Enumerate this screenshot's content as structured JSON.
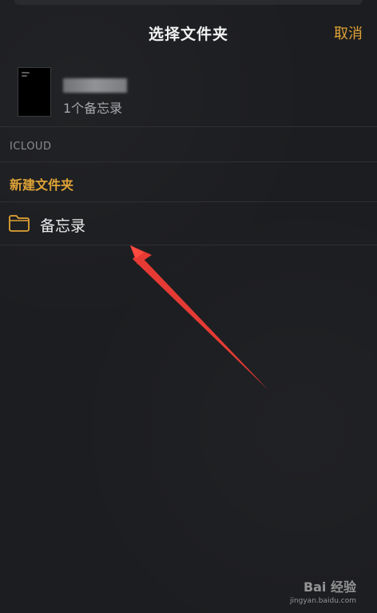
{
  "header": {
    "title": "选择文件夹",
    "cancel_label": "取消"
  },
  "note": {
    "count_label": "1个备忘录"
  },
  "section": {
    "header": "ICLOUD",
    "new_folder_label": "新建文件夹"
  },
  "folders": [
    {
      "label": "备忘录",
      "icon": "folder-icon"
    }
  ],
  "colors": {
    "accent": "#e0a336",
    "background": "#1c1d20",
    "annotation_arrow": "#e53b34"
  },
  "watermark": {
    "text": "Bai 经验",
    "url": "jingyan.baidu.com"
  }
}
